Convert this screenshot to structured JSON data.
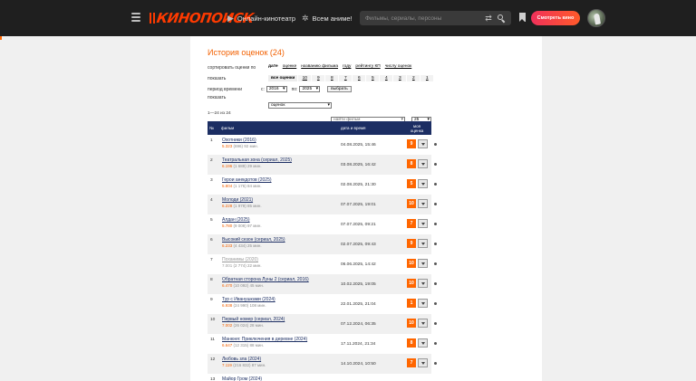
{
  "header": {
    "logo_text": "КИНОПОИСК",
    "nav": [
      {
        "label": "Онлайн-кинотеатр",
        "icon": "play-icon"
      },
      {
        "label": "Всем аниме!",
        "icon": "anime-icon"
      }
    ],
    "search_placeholder": "Фильмы, сериалы, персоны",
    "watch_button": "Смотреть кино",
    "accent": "#ff5a2a"
  },
  "page": {
    "title": "История оценок (24)",
    "sort_label": "сортировать оценки по",
    "sort_options": [
      "дате",
      "оценке",
      "названию фильма",
      "году",
      "рейтингу КП",
      "числу оценок"
    ],
    "show_label": "показать",
    "show_options": [
      "все оценки",
      "10",
      "9",
      "8",
      "7",
      "6",
      "5",
      "4",
      "3",
      "2",
      "1"
    ],
    "period_label": "период времени",
    "from_label": "с:",
    "from_value": "2016",
    "to_label": "по:",
    "to_value": "2025",
    "choose_button": "выбрать",
    "show2_label": "показать",
    "show2_value": "оценок",
    "count_label": "1—24 из 24",
    "find_placeholder": "найти фильм",
    "per_page": "25"
  },
  "table": {
    "col_no": "№",
    "col_film": "фильм",
    "col_date": "дата и время",
    "col_my": "моя оценка",
    "rows": [
      {
        "num": "1",
        "title": "Охотники (2016)",
        "rating": "5.323",
        "meta": " (696) 92 мин.",
        "date": "04.08.2025, 15:46",
        "vote": "9",
        "grey": false
      },
      {
        "num": "2",
        "title": "Театральная зона (сериал, 2025)",
        "rating": "6.196",
        "meta": " (1 689) 29 мин.",
        "date": "03.08.2025, 16:42",
        "vote": "8",
        "grey": false
      },
      {
        "num": "3",
        "title": "Герои анекдотов (2025)",
        "rating": "5.804",
        "meta": " (1 176) 84 мин.",
        "date": "02.08.2025, 21:30",
        "vote": "5",
        "grey": false
      },
      {
        "num": "4",
        "title": "Молоди (2021)",
        "rating": "6.228",
        "meta": " (1 979) 85 мин.",
        "date": "07.07.2025, 19:01",
        "vote": "10",
        "grey": false
      },
      {
        "num": "5",
        "title": "Алдан (2025)",
        "rating": "5.780",
        "meta": " (9 009) 97 мин.",
        "date": "07.07.2025, 09:21",
        "vote": "7",
        "grey": false
      },
      {
        "num": "6",
        "title": "Высокий сезон (сериал, 2025)",
        "rating": "6.233",
        "meta": " (4 434) 25 мин.",
        "date": "02.07.2025, 09:43",
        "vote": "9",
        "grey": false
      },
      {
        "num": "7",
        "title": "Поханимы (2020)",
        "rating": "7.001",
        "meta": " (2 774) 22 мин.",
        "date": "06.06.2025, 14:42",
        "vote": "10",
        "grey": true
      },
      {
        "num": "8",
        "title": "Обратная сторона Луны 2 (сериал, 2016)",
        "rating": "6.470",
        "meta": " (10 092) 45 мин.",
        "date": "10.02.2025, 19:05",
        "vote": "10",
        "grey": false
      },
      {
        "num": "9",
        "title": "Тур с Иванушками (2024)",
        "rating": "6.938",
        "meta": " (24 990) 108 мин.",
        "date": "22.01.2025, 21:04",
        "vote": "1",
        "grey": false
      },
      {
        "num": "10",
        "title": "Первый номер (сериал, 2024)",
        "rating": "7.002",
        "meta": " (26 024) 28 мин.",
        "date": "07.12.2024, 06:35",
        "vote": "10",
        "grey": false
      },
      {
        "num": "11",
        "title": "Манюня: Приключения в деревне (2024)",
        "rating": "6.647",
        "meta": " (12 315) 88 мин.",
        "date": "17.11.2024, 21:34",
        "vote": "8",
        "grey": false
      },
      {
        "num": "12",
        "title": "Любовь зла (2024)",
        "rating": "7.119",
        "meta": " (216 832) 87 мин.",
        "date": "14.10.2024, 10:50",
        "vote": "7",
        "grey": false
      },
      {
        "num": "13",
        "title": "Майор Гром (2024)",
        "rating": "",
        "meta": "",
        "date": "",
        "vote": "",
        "grey": false
      }
    ]
  }
}
